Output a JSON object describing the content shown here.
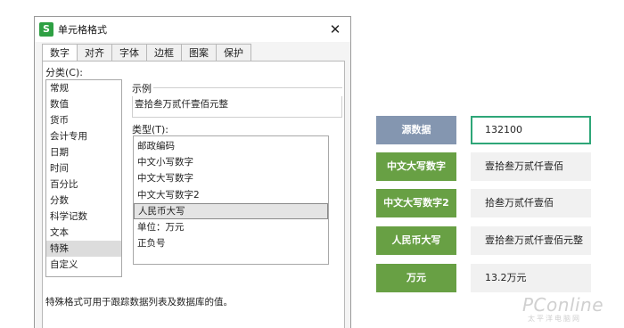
{
  "dialog": {
    "title": "单元格格式",
    "app_icon": "S",
    "close_glyph": "✕",
    "tabs": [
      "数字",
      "对齐",
      "字体",
      "边框",
      "图案",
      "保护"
    ],
    "category_label": "分类(C):",
    "categories": [
      "常规",
      "数值",
      "货币",
      "会计专用",
      "日期",
      "时间",
      "百分比",
      "分数",
      "科学记数",
      "文本",
      "特殊",
      "自定义"
    ],
    "selected_category": "特殊",
    "sample_label": "示例",
    "sample_value": "壹拾叁万贰仟壹佰元整",
    "type_label": "类型(T):",
    "types": [
      "邮政编码",
      "中文小写数字",
      "中文大写数字",
      "中文大写数字2",
      "人民币大写",
      "单位：万元",
      "正负号"
    ],
    "selected_type": "人民币大写",
    "description": "特殊格式可用于跟踪数据列表及数据库的值。"
  },
  "examples": [
    {
      "label": "源数据",
      "value": "132100"
    },
    {
      "label": "中文大写数字",
      "value": "壹拾叁万贰仟壹佰"
    },
    {
      "label": "中文大写数字2",
      "value": "拾叁万贰仟壹佰"
    },
    {
      "label": "人民币大写",
      "value": "壹拾叁万贰仟壹佰元整"
    },
    {
      "label": "万元",
      "value": "13.2万元"
    }
  ],
  "watermark": {
    "main": "PConline",
    "sub": "太平洋电脑网"
  },
  "colors": {
    "source_label": "#8496b0",
    "label_green": "#68a044",
    "app_icon": "#2ea043",
    "outline": "#2ea678"
  }
}
